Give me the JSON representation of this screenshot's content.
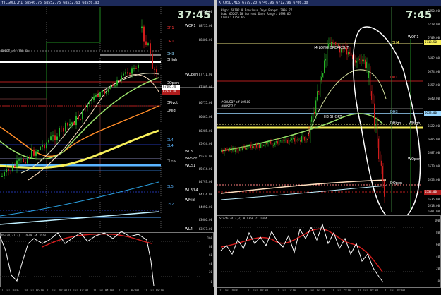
{
  "left_chart": {
    "title": "YTCGOLD,H1",
    "header": "YTCGOLD,H1  68540.75 68552.75 68532.63 68556.93",
    "clock": "37:45",
    "levels": [
      "DR1",
      "DR1",
      "DH3",
      "DHigh",
      "WOR1",
      "DOpen",
      "WOpen",
      "DPivot",
      "DMid",
      "DL4",
      "DL4",
      "DLow",
      "WL3",
      "WPivot",
      "WOS1",
      "DL5",
      "DS2",
      "WL3/L4",
      "WMid",
      "WL4"
    ],
    "price_axis": [
      "69750.00",
      "68735.00",
      "68406.00",
      "67771.00",
      "67405.00",
      "66775.00",
      "66465.00",
      "66285.00",
      "65934.00",
      "65510.00",
      "65074.00",
      "64793.00",
      "64374.00",
      "64050.00",
      "63686.00",
      "63237.00"
    ],
    "price_tags": [
      "67405.00",
      "67348.00",
      "66650.00"
    ],
    "indicator_label": "DS(24,21,2) 1.2619 74.2629",
    "indicator_axis": [
      "100",
      "80",
      "60",
      "40",
      "20",
      "0"
    ],
    "time_axis": [
      "21 Jul 2016",
      "20 Jul 06:00",
      "21 Jul 20:00",
      "21 Jul 02:00",
      "21 Jul 04:00",
      "21 Jul 06:00",
      "21 Jul 08:00"
    ],
    "notes": [
      "BRRBT_uff 109.60"
    ]
  },
  "right_chart": {
    "title": "XTCUSD,M15",
    "header": "XTCUSD,M15  6779.20 6740.96 6712.96 6706.30",
    "clock": "7:45",
    "info_lines": [
      "High: 68192.0     Previous Days Range: 2936.77",
      "Low: 65267.10     Current Days Range: 1998.65",
      "Close: 6753.66"
    ],
    "levels": [
      "DH4",
      "WOR1",
      "DR1",
      "DH3",
      "DHigh",
      "WHigh",
      "WOpen",
      "DOpen"
    ],
    "annotations": [
      "H4 LONG BREAKOUT",
      "H3 SHORT",
      "#CBUSD7 off 109.80",
      "#BUSD7 C"
    ],
    "price_axis": [
      "6750.00",
      "6728.00",
      "6709.00",
      "6692.00",
      "6674.00",
      "6657.00",
      "6640.00",
      "6622.00",
      "6605.00",
      "6587.00",
      "6570.00",
      "6553.00",
      "6535.00",
      "6518.00",
      "6501.00"
    ],
    "price_tags": [
      "6713.50",
      "6653.00",
      "6534.00"
    ],
    "indicator_label": "Stoch(24,2,3) 8.1368 22.1044",
    "indicator_axis": [
      "100",
      "80",
      "60",
      "40",
      "20",
      "0"
    ],
    "time_axis": [
      "21 Jul 2016",
      "21 Jul 10:30",
      "21 Jul 12:00",
      "21 Jul 13:30",
      "21 Jul 15:00",
      "21 Jul 16:30",
      "21 Jul 18:00",
      "21 Jul 19:30"
    ]
  },
  "colors": {
    "bull": "#27b227",
    "bear": "#d11c1c",
    "yellow": "#f7ef5a",
    "lightblue": "#5ab4ff",
    "orange": "#ff8c28",
    "green_ma": "#9be26a",
    "stroke": "#ffffff"
  }
}
